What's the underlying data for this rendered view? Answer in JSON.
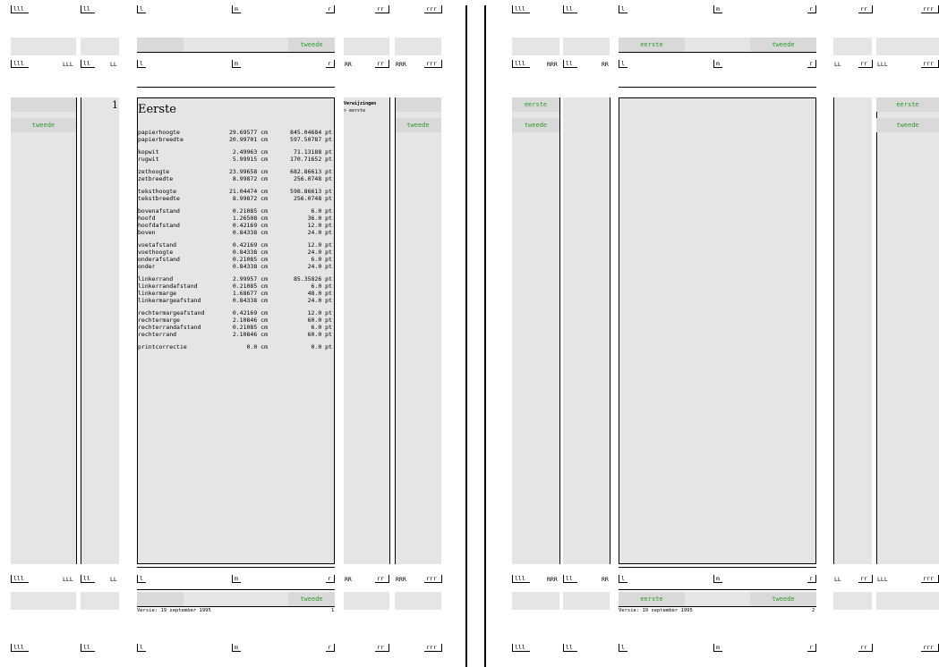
{
  "markers": {
    "lll": "lll",
    "ll": "ll",
    "l": "l",
    "m": "m",
    "r": "r",
    "rr": "rr",
    "rrr": "rrr",
    "LLL": "LLL",
    "LL": "LL",
    "RR": "RR",
    "RRR": "RRR"
  },
  "page1": {
    "page_number": "1",
    "title": "Eerste",
    "header_tab": "tweede",
    "footer_tab": "tweede",
    "left_nav": [
      "tweede"
    ],
    "right_panel": {
      "heading": "Verwijzingen",
      "item": "> eerste"
    },
    "right_nav": [
      "tweede"
    ],
    "version": "Versie: 19 september 1995",
    "footer_page": "1",
    "dimensions": [
      [
        [
          "papierhoogte",
          "29.69577 cm",
          "845.04684 pt"
        ],
        [
          "papierbreedte",
          "20.99701 cm",
          "597.50787 pt"
        ]
      ],
      [
        [
          "kopwit",
          "2.49963 cm",
          "71.13188 pt"
        ],
        [
          "rugwit",
          "5.99915 cm",
          "170.71652 pt"
        ]
      ],
      [
        [
          "zethoogte",
          "23.99658 cm",
          "682.86613 pt"
        ],
        [
          "zetbreedte",
          "8.99872 cm",
          "256.0748 pt"
        ]
      ],
      [
        [
          "teksthoogte",
          "21.04474 cm",
          "598.86613 pt"
        ],
        [
          "tekstbreedte",
          "8.99872 cm",
          "256.0748 pt"
        ]
      ],
      [
        [
          "bovenafstand",
          "0.21085 cm",
          "6.0 pt"
        ],
        [
          "hoofd",
          "1.26508 cm",
          "36.0 pt"
        ],
        [
          "hoofdafstand",
          "0.42169 cm",
          "12.0 pt"
        ],
        [
          "boven",
          "0.84338 cm",
          "24.0 pt"
        ]
      ],
      [
        [
          "voetafstand",
          "0.42169 cm",
          "12.0 pt"
        ],
        [
          "voethoogte",
          "0.84338 cm",
          "24.0 pt"
        ],
        [
          "onderafstand",
          "0.21085 cm",
          "6.0 pt"
        ],
        [
          "onder",
          "0.84338 cm",
          "24.0 pt"
        ]
      ],
      [
        [
          "linkerrand",
          "2.99957 cm",
          "85.35826 pt"
        ],
        [
          "linkerrandafstand",
          "0.21085 cm",
          "6.0 pt"
        ],
        [
          "linkermarge",
          "1.68677 cm",
          "48.0 pt"
        ],
        [
          "linkermargeafstand",
          "0.84338 cm",
          "24.0 pt"
        ]
      ],
      [
        [
          "rechtermargeafstand",
          "0.42169 cm",
          "12.0 pt"
        ],
        [
          "rechtermarge",
          "2.10846 cm",
          "60.0 pt"
        ],
        [
          "rechterrandafstand",
          "0.21085 cm",
          "6.0 pt"
        ],
        [
          "rechterrand",
          "2.10846 cm",
          "60.0 pt"
        ]
      ],
      [
        [
          "printcorrectie",
          "0.0 cm",
          "0.0 pt"
        ]
      ]
    ]
  },
  "page2": {
    "header_tabs": [
      "eerste",
      "tweede"
    ],
    "footer_tabs": [
      "eerste",
      "tweede"
    ],
    "left_nav": [
      "eerste",
      "tweede"
    ],
    "right_nav": [
      "eerste",
      "tweede"
    ],
    "version": "Versie: 19 september 1995",
    "footer_page": "2"
  }
}
